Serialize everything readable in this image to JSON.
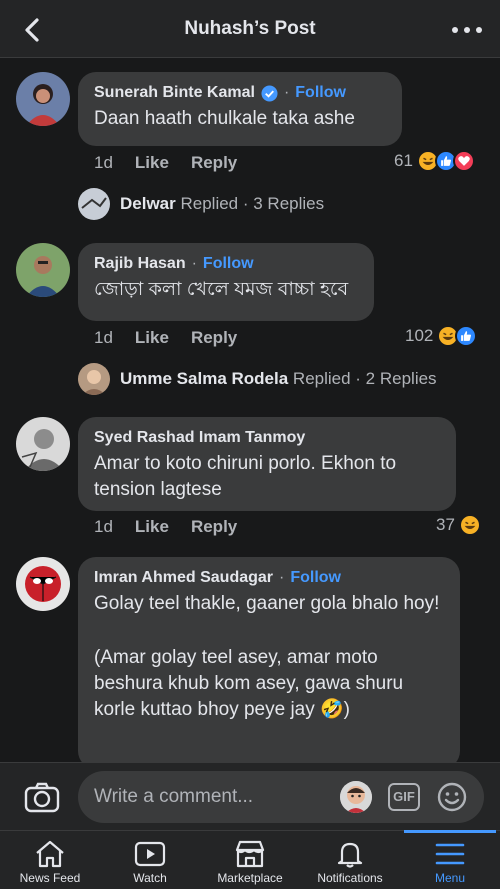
{
  "header": {
    "title": "Nuhash’s Post"
  },
  "comments": [
    {
      "name": "Sunerah Binte Kamal",
      "follow": "Follow",
      "dot": "·",
      "text": "Daan haath chulkale taka ashe",
      "time": "1d",
      "like": "Like",
      "reply": "Reply",
      "reaction_count": "61",
      "reply_summary": {
        "name": "Delwar",
        "text": "Replied · 3 Replies"
      }
    },
    {
      "name": "Rajib Hasan",
      "follow": "Follow",
      "dot": "·",
      "text": "জোড়া কলা খেলে যমজ বাচ্চা হবে",
      "time": "1d",
      "like": "Like",
      "reply": "Reply",
      "reaction_count": "102",
      "reply_summary": {
        "name": "Umme Salma Rodela",
        "text": "Replied · 2 Replies"
      }
    },
    {
      "name": "Syed Rashad Imam Tanmoy",
      "text": "Amar to koto chiruni porlo. Ekhon to tension lagtese",
      "time": "1d",
      "like": "Like",
      "reply": "Reply",
      "reaction_count": "37"
    },
    {
      "name": "Imran Ahmed Saudagar",
      "follow": "Follow",
      "dot": "·",
      "text_line1": "Golay teel thakle, gaaner gola bhalo hoy!",
      "text_line2": "(Amar golay teel asey, amar moto beshura khub kom asey, gawa shuru korle kuttao bhoy peye jay 🤣)"
    }
  ],
  "composer": {
    "placeholder": "Write a comment...",
    "gif": "GIF"
  },
  "tabs": [
    {
      "label": "News Feed",
      "icon": "home-icon"
    },
    {
      "label": "Watch",
      "icon": "watch-icon"
    },
    {
      "label": "Marketplace",
      "icon": "marketplace-icon"
    },
    {
      "label": "Notifications",
      "icon": "bell-icon"
    },
    {
      "label": "Menu",
      "icon": "menu-icon",
      "active": true
    }
  ],
  "colors": {
    "accent": "#4599ff",
    "bubble": "#3a3b3c",
    "background": "#18191a"
  }
}
